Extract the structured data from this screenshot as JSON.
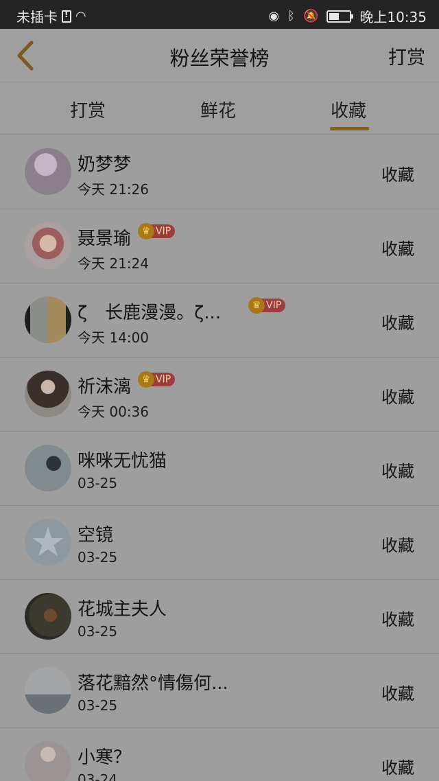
{
  "status_bar": {
    "carrier": "未插卡",
    "time": "晚上10:35",
    "icons": [
      "sim-warning-icon",
      "wifi-icon",
      "eye-icon",
      "bluetooth-icon",
      "notifications-off-icon",
      "battery-icon"
    ]
  },
  "header": {
    "title": "粉丝荣誉榜",
    "action": "打赏",
    "back_icon": "chevron-left-icon"
  },
  "tabs": [
    {
      "label": "打赏",
      "active": false
    },
    {
      "label": "鲜花",
      "active": false
    },
    {
      "label": "收藏",
      "active": true
    }
  ],
  "fans": [
    {
      "name": "奶梦梦",
      "time": "今天 21:26",
      "vip": false,
      "action": "收藏",
      "avatar_color": "#8a7f8b"
    },
    {
      "name": "聂景瑜",
      "time": "今天 21:24",
      "vip": true,
      "vip_label": "VIP",
      "action": "收藏",
      "avatar_color": "#8f5f63"
    },
    {
      "name": "ζ　长鹿漫漫。ζ...",
      "time": "今天 14:00",
      "vip": true,
      "vip_label": "VIP",
      "action": "收藏",
      "avatar_color": "#7b7a6a"
    },
    {
      "name": "祈沫漓",
      "time": "今天 00:36",
      "vip": true,
      "vip_label": "VIP",
      "action": "收藏",
      "avatar_color": "#5a4d49"
    },
    {
      "name": "咪咪无忧猫",
      "time": "03-25",
      "vip": false,
      "action": "收藏",
      "avatar_color": "#6f7678"
    },
    {
      "name": "空镜",
      "time": "03-25",
      "vip": false,
      "action": "收藏",
      "avatar_color": "#8e98a1"
    },
    {
      "name": "花城主夫人",
      "time": "03-25",
      "vip": false,
      "action": "收藏",
      "avatar_color": "#3c3a2e"
    },
    {
      "name": "落花黯然°情傷何...",
      "time": "03-25",
      "vip": false,
      "action": "收藏",
      "avatar_color": "#7c8086"
    },
    {
      "name": "小寒？",
      "time": "03-24",
      "vip": false,
      "action": "收藏",
      "avatar_color": "#9a9494"
    }
  ]
}
